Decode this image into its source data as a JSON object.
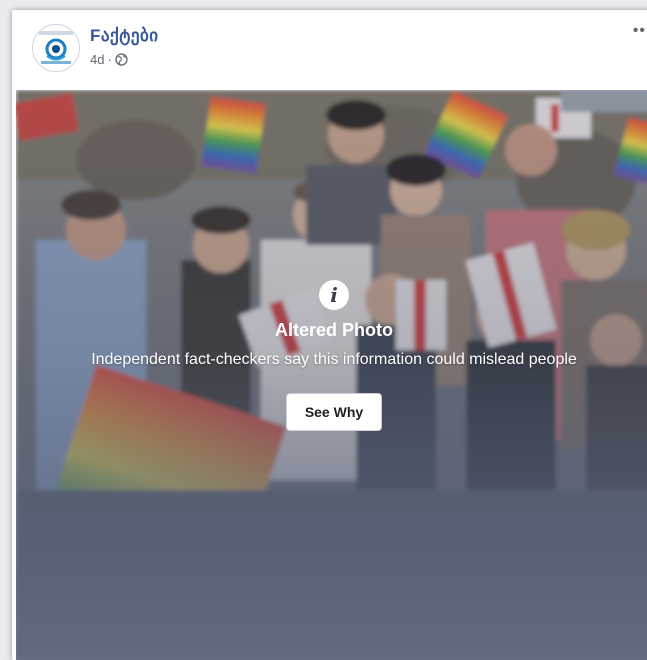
{
  "post": {
    "page_name": "Fაქტები",
    "time": "4d",
    "separator": "·",
    "privacy_icon": "globe-icon",
    "more_icon": "more-options-icon",
    "more_label": "••"
  },
  "warning": {
    "icon": "info-icon",
    "icon_glyph": "i",
    "title": "Altered Photo",
    "text": "Independent fact-checkers say this information could mislead people",
    "button_label": "See Why"
  },
  "colors": {
    "page_name": "#365899",
    "overlay": "#5a6480",
    "button_bg": "#ffffff"
  }
}
